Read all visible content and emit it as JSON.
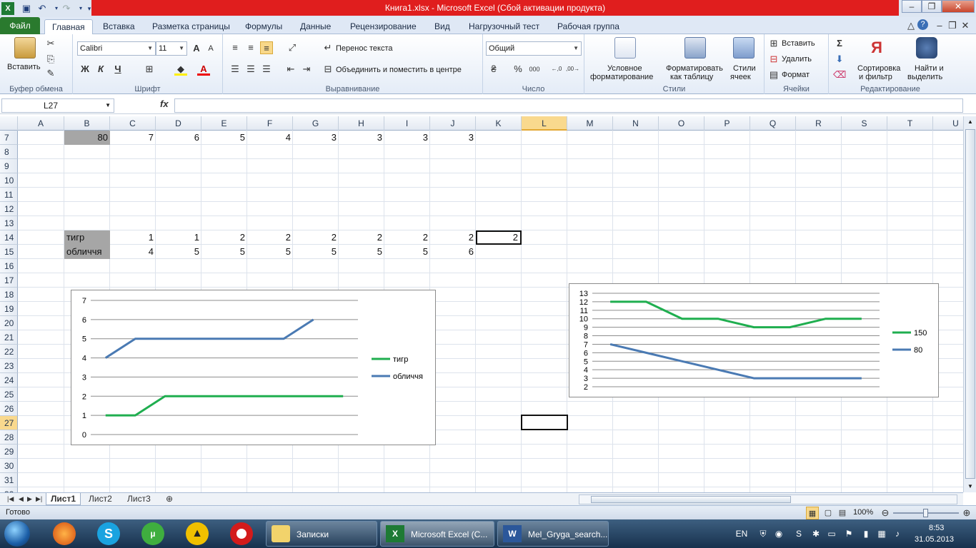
{
  "window": {
    "title": "Книга1.xlsx  -  Microsoft Excel (Сбой активации продукта)"
  },
  "tabs": [
    "Файл",
    "Главная",
    "Вставка",
    "Разметка страницы",
    "Формулы",
    "Данные",
    "Рецензирование",
    "Вид",
    "Нагрузочный тест",
    "Рабочая группа"
  ],
  "ribbon": {
    "clipboard": {
      "paste": "Вставить",
      "label": "Буфер обмена"
    },
    "font": {
      "name": "Calibri",
      "size": "11",
      "bold": "Ж",
      "italic": "К",
      "underline": "Ч",
      "label": "Шрифт"
    },
    "align": {
      "wrap": "Перенос текста",
      "merge": "Объединить и поместить в центре",
      "label": "Выравнивание"
    },
    "number": {
      "format": "Общий",
      "percent": "%",
      "thousands": "000",
      "inc": ",0\n,00",
      "label": "Число"
    },
    "styles": {
      "conditional1": "Условное",
      "conditional2": "форматирование",
      "table1": "Форматировать",
      "table2": "как таблицу",
      "cell1": "Стили",
      "cell2": "ячеек",
      "label": "Стили"
    },
    "cells": {
      "insert": "Вставить",
      "delete": "Удалить",
      "format": "Формат",
      "label": "Ячейки"
    },
    "edit": {
      "sort1": "Сортировка",
      "sort2": "и фильтр",
      "find1": "Найти и",
      "find2": "выделить",
      "label": "Редактирование"
    }
  },
  "formula": {
    "namebox": "L27",
    "fx": "fx",
    "value": ""
  },
  "columns": [
    "A",
    "B",
    "C",
    "D",
    "E",
    "F",
    "G",
    "H",
    "I",
    "J",
    "K",
    "L",
    "M",
    "N",
    "O",
    "P",
    "Q",
    "R",
    "S",
    "T",
    "U"
  ],
  "rows": [
    "7",
    "8",
    "9",
    "10",
    "11",
    "12",
    "13",
    "14",
    "15",
    "16",
    "17",
    "18",
    "19",
    "20",
    "21",
    "22",
    "23",
    "24",
    "25",
    "26",
    "27",
    "28",
    "29",
    "30",
    "31",
    "32"
  ],
  "cells": {
    "r7": [
      "80",
      "7",
      "6",
      "5",
      "4",
      "3",
      "3",
      "3",
      "3"
    ],
    "r14": {
      "label": "тигр",
      "values": [
        "1",
        "1",
        "2",
        "2",
        "2",
        "2",
        "2",
        "2",
        "2"
      ]
    },
    "r15": {
      "label": "обличчя",
      "values": [
        "4",
        "5",
        "5",
        "5",
        "5",
        "5",
        "5",
        "6"
      ]
    }
  },
  "chart_data": [
    {
      "type": "line",
      "ylim": [
        0,
        7
      ],
      "yticks": [
        "0",
        "1",
        "2",
        "3",
        "4",
        "5",
        "6",
        "7"
      ],
      "series": [
        {
          "name": "тигр",
          "color": "#1fae4f",
          "values": [
            1,
            1,
            2,
            2,
            2,
            2,
            2,
            2,
            2
          ]
        },
        {
          "name": "обличчя",
          "color": "#4a7ab3",
          "values": [
            4,
            5,
            5,
            5,
            5,
            5,
            5,
            6
          ]
        }
      ]
    },
    {
      "type": "line",
      "ylim": [
        2,
        13
      ],
      "yticks": [
        "2",
        "3",
        "4",
        "5",
        "6",
        "7",
        "8",
        "9",
        "10",
        "11",
        "12",
        "13"
      ],
      "series": [
        {
          "name": "150",
          "color": "#1fae4f",
          "values": [
            12,
            12,
            10,
            10,
            9,
            9,
            10,
            10
          ]
        },
        {
          "name": "80",
          "color": "#4a7ab3",
          "values": [
            7,
            6,
            5,
            4,
            3,
            3,
            3,
            3
          ]
        }
      ]
    }
  ],
  "sheets": [
    "Лист1",
    "Лист2",
    "Лист3"
  ],
  "status": {
    "ready": "Готово",
    "zoom": "100%"
  },
  "taskbar": {
    "tasks": [
      "Записки",
      "Microsoft Excel (С...",
      "Mel_Gryga_search..."
    ],
    "lang": "EN",
    "time": "8:53",
    "date": "31.05.2013"
  }
}
